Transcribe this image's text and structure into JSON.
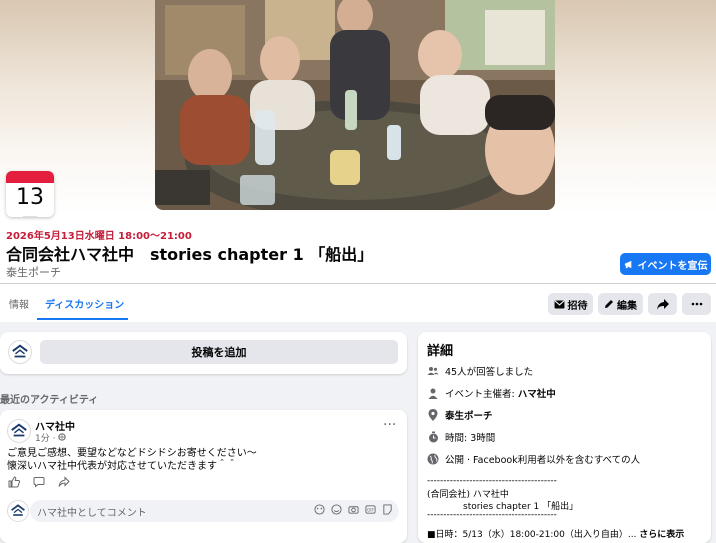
{
  "event": {
    "day": "13日",
    "datetime": "2026年5月13日水曜日 18:00～21:00",
    "title": "合同会社ハマ社中　stories chapter 1 「船出」",
    "location": "泰生ポーチ",
    "share_label": "イベントを宣伝"
  },
  "tabs": [
    {
      "label": "情報"
    },
    {
      "label": "ディスカッション"
    }
  ],
  "actions": {
    "invite": "招待",
    "edit": "編集"
  },
  "composer": {
    "button": "投稿を追加"
  },
  "activity": {
    "heading": "最近のアクティビティ"
  },
  "post": {
    "author": "ハマ社中",
    "time": "1分",
    "line1": "ご意見ご感想、要望などなどドシドシお寄せください～",
    "line2": "懐深いハマ社中代表が対応させていただきます＾＾",
    "comment_placeholder": "ハマ社中としてコメント"
  },
  "details": {
    "title": "詳細",
    "responded": "45人が回答しました",
    "host_prefix": "イベント主催者: ",
    "host_name": "ハマ社中",
    "place": "泰生ポーチ",
    "duration": "時間: 3時間",
    "privacy": "公開 · Facebook利用者以外を含むすべての人",
    "sep1": "----------------------------------------",
    "org": "(合同会社) ハマ社中",
    "chapter": "stories chapter 1 「船出」",
    "sep2": "----------------------------------------",
    "schedule": "■日時：5/13（水）18:00-21:00（出入り自由）...",
    "see_more": "さらに表示"
  },
  "colors": {
    "accent": "#1877f2",
    "date_red": "#c41e3a",
    "badge_red": "#e41e3f"
  }
}
